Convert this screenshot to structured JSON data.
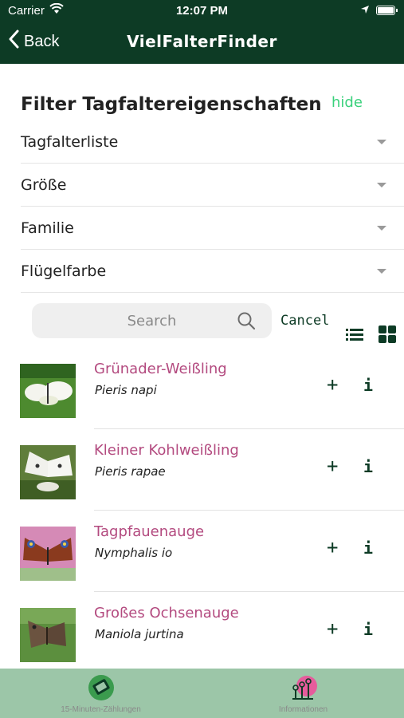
{
  "status_bar": {
    "carrier": "Carrier",
    "time": "12:07 PM"
  },
  "nav": {
    "back_label": "Back",
    "title": "VielFalterFinder"
  },
  "filter": {
    "title": "Filter Tagfaltereigenschaften",
    "hide_label": "hide",
    "rows": [
      {
        "label": "Tagfalterliste"
      },
      {
        "label": "Größe"
      },
      {
        "label": "Familie"
      },
      {
        "label": "Flügelfarbe"
      }
    ]
  },
  "search": {
    "placeholder": "Search",
    "cancel_label": "Cancel"
  },
  "butterflies": [
    {
      "name": "Grünader-Weißling",
      "latin": "Pieris napi",
      "add": "+",
      "info": "i"
    },
    {
      "name": "Kleiner Kohlweißling",
      "latin": "Pieris rapae",
      "add": "+",
      "info": "i"
    },
    {
      "name": "Tagpfauenauge",
      "latin": "Nymphalis io",
      "add": "+",
      "info": "i"
    },
    {
      "name": "Großes Ochsenauge",
      "latin": "Maniola jurtina",
      "add": "+",
      "info": "i"
    }
  ],
  "tabbar": {
    "tabs": [
      {
        "label": "15-Minuten-Zählungen",
        "icon": "counter-icon"
      },
      {
        "label": "Informationen",
        "icon": "flowers-icon"
      }
    ]
  },
  "colors": {
    "header_bg": "#0d3b25",
    "accent_green": "#3ad17c",
    "name_pink": "#b34a7f",
    "tabbar_bg": "#9cc6a8"
  }
}
